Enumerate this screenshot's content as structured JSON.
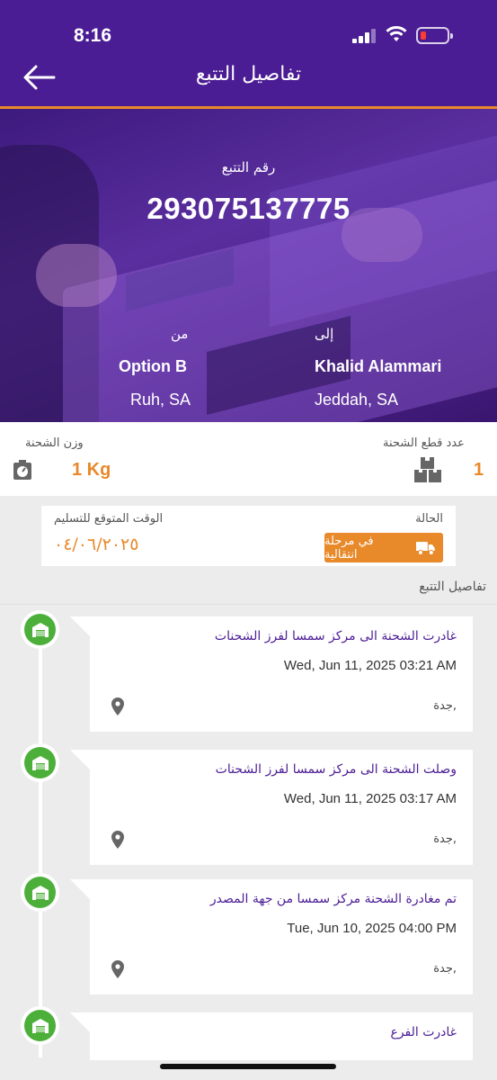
{
  "status_bar": {
    "time": "8:16"
  },
  "header": {
    "title": "تفاصيل التتبع"
  },
  "shipment": {
    "tracking_label": "رقم التتبع",
    "tracking_number": "293075137775",
    "to_label": "إلى",
    "to_name": "Khalid Alammari",
    "to_city": "Jeddah, SA",
    "from_label": "من",
    "from_name": "Option B",
    "from_city": "Ruh, SA"
  },
  "info": {
    "weight_label": "وزن الشحنة",
    "weight_value": "1 Kg",
    "pieces_label": "عدد قطع الشحنة",
    "pieces_value": "1"
  },
  "status": {
    "eta_label": "الوقت المتوقع للتسليم",
    "eta_value": "٠٤/٠٦/٢٠٢٥",
    "status_label": "الحالة",
    "status_value": "في مرحلة انتقالية"
  },
  "section_title": "تفاصيل التتبع",
  "events": [
    {
      "title": "غادرت الشحنة الى مركز سمسا لفرز الشحنات",
      "date": "Wed, Jun 11, 2025 03:21 AM",
      "city": "جدة,"
    },
    {
      "title": "وصلت الشحنة الى مركز سمسا لفرز الشحنات",
      "date": "Wed, Jun 11, 2025 03:17 AM",
      "city": "جدة,"
    },
    {
      "title": "تم مغادرة الشحنة مركز سمسا  من جهة المصدر",
      "date": "Tue, Jun 10, 2025 04:00 PM",
      "city": "جدة,"
    },
    {
      "title": "غادرت الفرع",
      "date": "",
      "city": ""
    }
  ],
  "colors": {
    "primary": "#4b1d94",
    "accent": "#e8892a",
    "success": "#4caf3a"
  }
}
